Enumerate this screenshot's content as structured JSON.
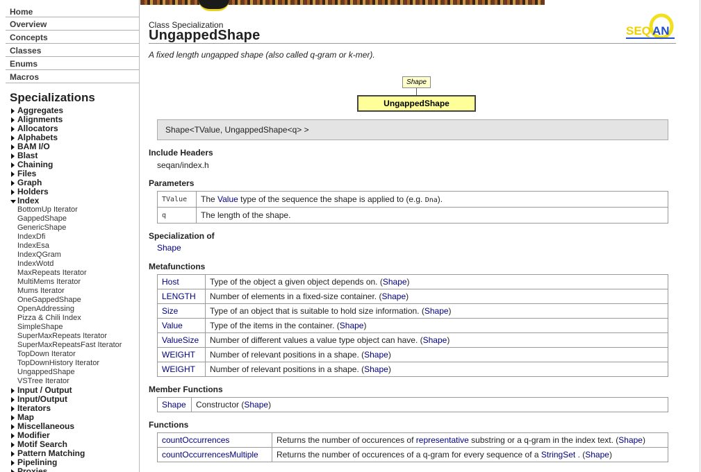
{
  "nav": {
    "top_links": [
      "Home",
      "Overview",
      "Concepts",
      "Classes",
      "Enums",
      "Macros"
    ],
    "heading": "Specializations",
    "categories_before": [
      "Aggregates",
      "Alignments",
      "Allocators",
      "Alphabets",
      "BAM I/O",
      "Blast",
      "Chaining",
      "Files",
      "Graph",
      "Holders"
    ],
    "open_category": "Index",
    "open_items": [
      "BottomUp Iterator",
      "GappedShape",
      "GenericShape",
      "IndexDfi",
      "IndexEsa",
      "IndexQGram",
      "IndexWotd",
      "MaxRepeats Iterator",
      "MultiMems Iterator",
      "Mums Iterator",
      "OneGappedShape",
      "OpenAddressing",
      "Pizza & Chili Index",
      "SimpleShape",
      "SuperMaxRepeats Iterator",
      "SuperMaxRepeatsFast Iterator",
      "TopDown Iterator",
      "TopDownHistory Iterator",
      "UngappedShape",
      "VSTree Iterator"
    ],
    "categories_after": [
      "Input / Output",
      "Input/Output",
      "Iterators",
      "Map",
      "Miscellaneous",
      "Modifier",
      "Motif Search",
      "Pattern Matching",
      "Pipelining",
      "Proxies"
    ]
  },
  "page": {
    "kind": "Class Specialization",
    "title": "UngappedShape",
    "summary": "A fixed length ungapped shape (also called q-gram or k-mer).",
    "logo": {
      "text_se": "SEQ",
      "text_an": "AN",
      "accent": "#f0e020",
      "ink": "#1f4fd0"
    },
    "graph": {
      "parent": "Shape",
      "node": "UngappedShape"
    },
    "signature": "Shape<TValue, UngappedShape<q> >",
    "include": {
      "heading": "Include Headers",
      "path": "seqan/index.h"
    },
    "parameters": {
      "heading": "Parameters",
      "rows": [
        {
          "name": "TValue",
          "pre": "The ",
          "link": "Value",
          "mid": " type of the sequence the shape is applied to (e.g. ",
          "code": "Dna",
          "post": ")."
        },
        {
          "name": "q",
          "text": "The length of the shape."
        }
      ]
    },
    "specialization_of": {
      "heading": "Specialization of",
      "link": "Shape"
    },
    "metafunctions": {
      "heading": "Metafunctions",
      "rows": [
        {
          "name": "Host",
          "desc": "Type of the object a given object depends on. (",
          "ref": "Shape",
          "end": ")"
        },
        {
          "name": "LENGTH",
          "desc": "Number of elements in a fixed-size container. (",
          "ref": "Shape",
          "end": ")"
        },
        {
          "name": "Size",
          "desc": "Type of an object that is suitable to hold size information. (",
          "ref": "Shape",
          "end": ")"
        },
        {
          "name": "Value",
          "desc": "Type of the items in the container. (",
          "ref": "Shape",
          "end": ")"
        },
        {
          "name": "ValueSize",
          "desc": "Number of different values a value type object can have. (",
          "ref": "Shape",
          "end": ")"
        },
        {
          "name": "WEIGHT",
          "desc": "Number of relevant positions in a shape. (",
          "ref": "Shape",
          "end": ")"
        },
        {
          "name": "WEIGHT",
          "desc": "Number of relevant positions in a shape. (",
          "ref": "Shape",
          "end": ")"
        }
      ]
    },
    "member_functions": {
      "heading": "Member Functions",
      "rows": [
        {
          "name": "Shape",
          "desc": "Constructor (",
          "ref": "Shape",
          "end": ")"
        }
      ]
    },
    "functions": {
      "heading": "Functions",
      "rows": [
        {
          "name": "countOccurrences",
          "d1": "Returns the number of occurences of ",
          "l1": "representative",
          "d2": " substring or a q-gram in the index text. (",
          "ref": "Shape",
          "end": ")"
        },
        {
          "name": "countOccurrencesMultiple",
          "d1": "Returns the number of occurences of a q-gram for every sequence of a ",
          "l1": "StringSet",
          "d2": " . (",
          "ref": "Shape",
          "end": ")"
        }
      ]
    }
  }
}
